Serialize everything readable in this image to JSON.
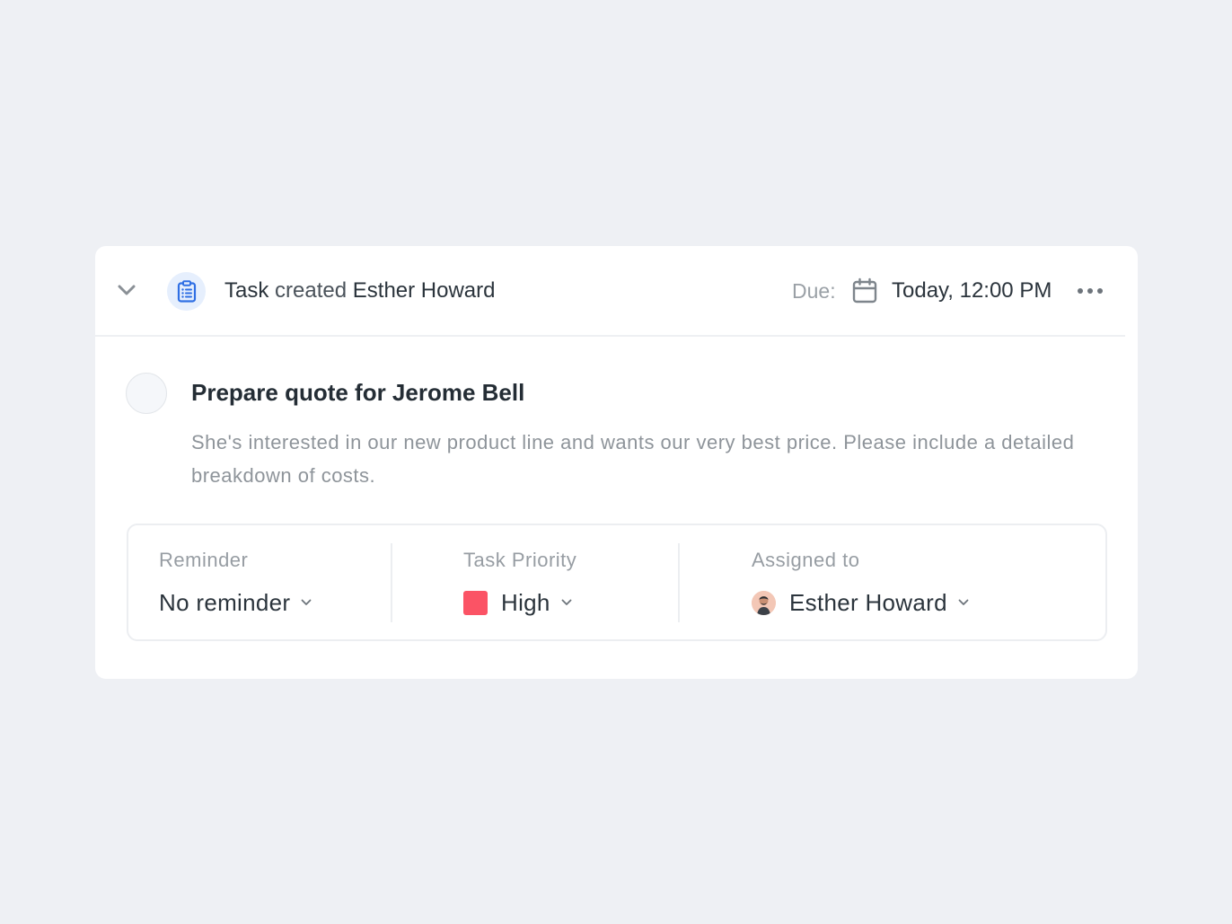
{
  "header": {
    "action_word": "Task",
    "action_verb": "created",
    "actor": "Esther Howard",
    "due_label": "Due:",
    "due_value": "Today, 12:00 PM"
  },
  "task": {
    "title": "Prepare quote for Jerome Bell",
    "description": "She's interested in our new product line and wants our very best price. Please include a detailed breakdown of costs."
  },
  "properties": {
    "reminder": {
      "label": "Reminder",
      "value": "No reminder"
    },
    "priority": {
      "label": "Task Priority",
      "value": "High",
      "color": "#fb5365"
    },
    "assignee": {
      "label": "Assigned to",
      "value": "Esther Howard"
    }
  },
  "icons": {
    "collapse": "chevron-down-icon",
    "task": "clipboard-list-icon",
    "calendar": "calendar-icon",
    "more": "more-horizontal-icon"
  },
  "colors": {
    "background": "#eef0f4",
    "card": "#ffffff",
    "accent": "#2f6fe4",
    "priority_high": "#fb5365"
  }
}
